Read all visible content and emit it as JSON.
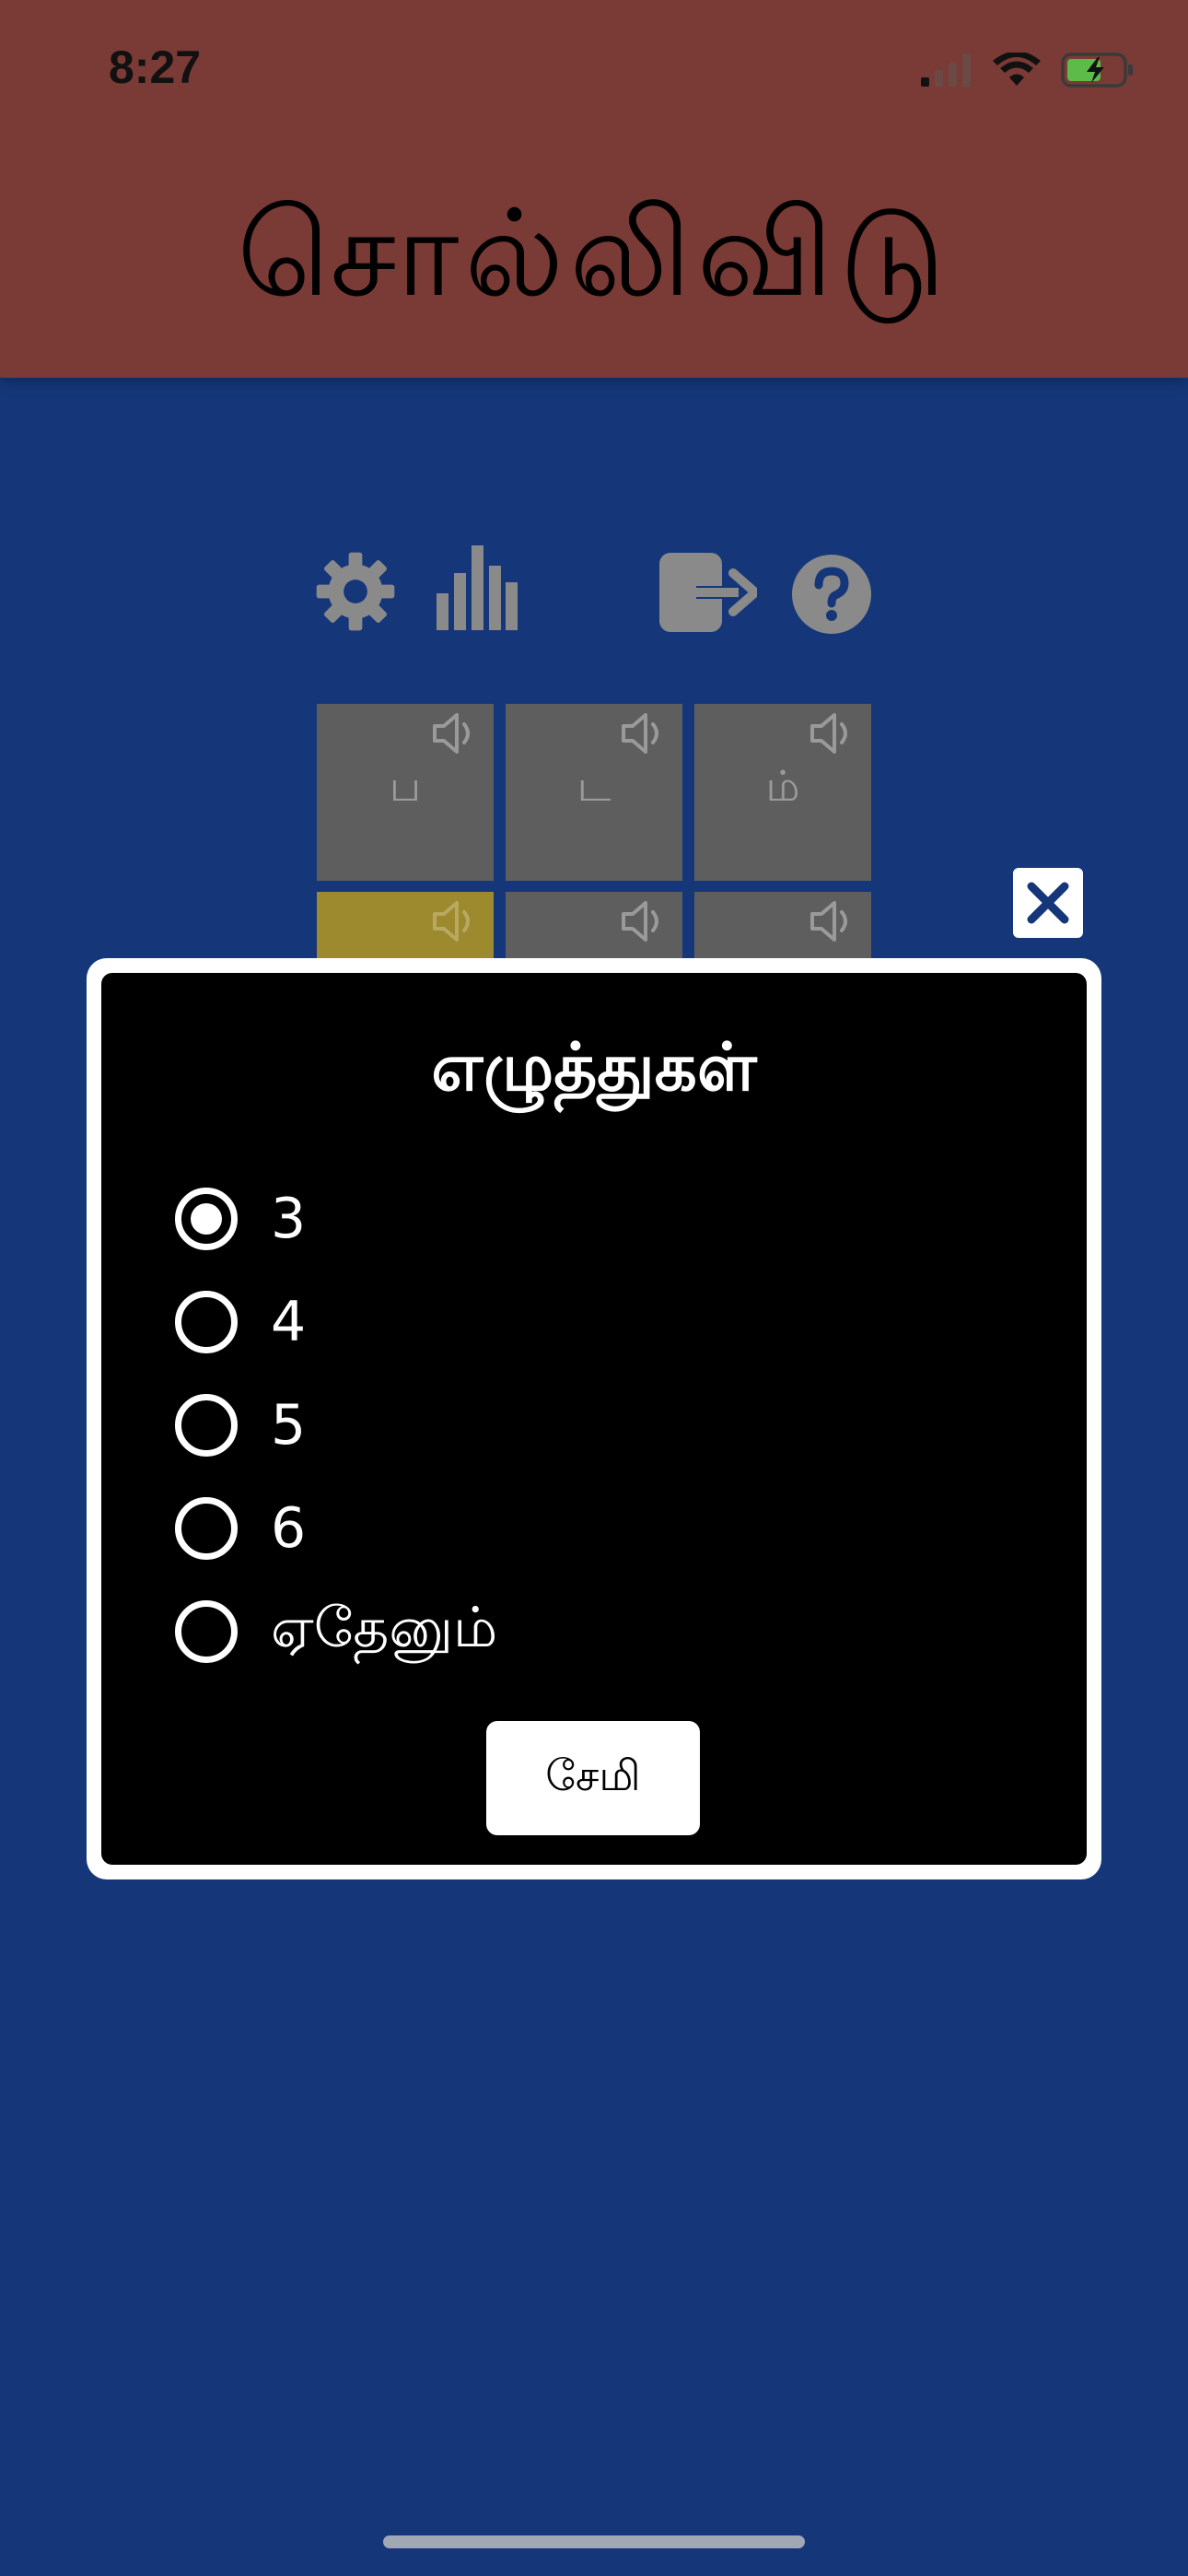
{
  "status_bar": {
    "time": "8:27"
  },
  "app": {
    "title": "சொல்லிவிடு"
  },
  "toolbar": {
    "icons": [
      "gear-icon",
      "bar-chart-icon",
      "sign-out-icon",
      "help-icon"
    ]
  },
  "board": {
    "rows": [
      [
        {
          "letter": "ப",
          "state": "absent"
        },
        {
          "letter": "ட",
          "state": "absent"
        },
        {
          "letter": "ம்",
          "state": "absent"
        }
      ],
      [
        {
          "letter": "",
          "state": "present"
        },
        {
          "letter": "",
          "state": "absent"
        },
        {
          "letter": "",
          "state": "absent"
        }
      ]
    ]
  },
  "modal": {
    "title": "எழுத்துகள்",
    "options": [
      {
        "label": "3",
        "selected": true
      },
      {
        "label": "4",
        "selected": false
      },
      {
        "label": "5",
        "selected": false
      },
      {
        "label": "6",
        "selected": false
      },
      {
        "label": "ஏதேனும்",
        "selected": false
      }
    ],
    "save_label": "சேமி",
    "close_icon": "close-icon"
  },
  "colors": {
    "header_bg": "#7a3a35",
    "page_bg": "#15377a",
    "tile_absent": "#5e5e5e",
    "tile_present": "#9d8a2e",
    "icon_gray": "#8a8a8a"
  }
}
